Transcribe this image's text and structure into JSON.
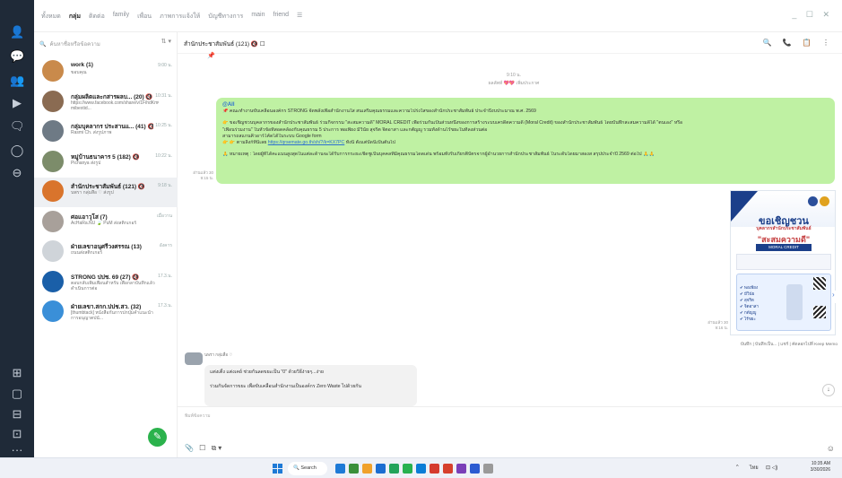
{
  "topbar": {
    "tabs": [
      "ทั้งหมด",
      "กลุ่ม",
      "ติดต่อ",
      "family",
      "เพื่อน",
      "ภาพการแจ้งให้",
      "บัญชีทางการ",
      "main",
      "friend"
    ],
    "active_tab": "กลุ่ม",
    "window_controls": "_ ☐ ✕"
  },
  "list": {
    "search_placeholder": "ค้นหาชื่อหรือข้อความ",
    "sort_label": "⇅ ▾",
    "chats": [
      {
        "name": "work (1)",
        "preview": "ขอบคุณ",
        "time": "9:00 น.",
        "color": "#c98a4b"
      },
      {
        "name": "กลุ่มผลิตและกสารผลบ... (20) 🔇",
        "preview": "https://www.facebook.com/share/v/1FihdKmCSu/?mibextid...",
        "time": "10:31 น.",
        "color": "#8a6b52"
      },
      {
        "name": "กลุ่มบุคลากร ประสานแ... (41) 🔇",
        "preview": "Rasmi Ch. ส่งรูปภาพ",
        "time": "10:25 น.",
        "color": "#6e7a85"
      },
      {
        "name": "หมู่บ้านธนาคาร 5 (182) 🔇",
        "preview": "Pichanya ส่งรูป",
        "time": "10:22 น.",
        "color": "#7c8c6a"
      },
      {
        "name": "สำนักประชาสัมพันธ์ (121) 🔇",
        "preview": "นพรา กลุ่มสื่อ ♡ ส่งรูป",
        "time": "9:18 น.",
        "color": "#d9742c"
      },
      {
        "name": "ศอแอาวุโส (7)",
        "preview": "AcHaRa.NU 🍃 PuM ส่งสติกเกอร์",
        "time": "เมื่อวาน",
        "color": "#a8a09a"
      },
      {
        "name": "ฝ่ายเลขาอนุศรีวงศรรณ (13)",
        "preview": "ถนนส่งสติกเกอร์",
        "time": "อังคาร",
        "color": "#cfd4d9"
      },
      {
        "name": "STRONG ปปช. 69 (27) 🔇",
        "preview": "ตอบกลับเพิ่มเพื่อนสำหรับ เพื่อกลาบันทึกแล้ว ดำเนินการต่อ",
        "time": "17.3.น.",
        "color": "#1a5fa8"
      },
      {
        "name": "ฝ่ายเลขา.สกก.ปปช.สว. (32)",
        "preview": "[thumbtack] หนังสือกันการปกปุ่มคำแนะนำการอนุญาตปนั...",
        "time": "17.3.น.",
        "color": "#3a8fd8"
      }
    ],
    "new_chat_icon": "chat-plus"
  },
  "conversation": {
    "title": "สำนักประชาสัมพันธ์ (121) 🔇 ☐",
    "tools": "🔍 📞 📋 ⋮",
    "pinned_line": "📌",
    "sys_time": "9:10 น.",
    "sys_text": "ผลลัพท์ 💖💖 เพิ่มประกาศ",
    "bubble_main": {
      "mention": "@All",
      "line1": "📌 คณะทำงานขับเคลื่อนองค์กร STRONG จัดพลังเพื่อสำนักงานใส สนเสริมคุณธรรมและความโปร่งใสของสำนักประชาสัมพันธ์ ประจำปีงบประมาณ พ.ศ. 2569",
      "line2": "👉 ขอเชิญชวนบุคลากรของสำนักประชาสัมพันธ์ ร่วมกิจกรรม \"สะสมความดี\" MORAL CREDIT เพื่อร่วมกันเป็นส่วนหนึ่งของการสร้างระบบเครดิตความดี (Moral Credit) ของสำนักประชาสัมพันธ์ โดยบันทึกสะสมความดีได้ \"ตนเอง\" หรือ",
      "line3": "\"เพื่อนร่วมงาน\" ในหัวข้อที่สอดคล้องกับคุณธรรม 5 ประการ พอเพียง มีวินัย สุจริต จิตอาสา และกตัญญู รวมทั้งด้านไร้ขยะในที่ลงส่วนต่อ",
      "line4": "สามารถสแกนคิวอาร์โค้ดได้ในระบบ Google form",
      "line5_prefix": "👉 👉 ตามลิงก์ที่นี่เลย ",
      "line5_link": "https://qrsemate.go.th/sh/?/k=KX7PC",
      "line5_suffix": " ทั้งนี้ ตั้งแต่บัดนี้เป็นต้นไป",
      "line6": "🙏 หมายเหตุ : โดยผู้ที่ได้คะแนนสูงสุดในแต่ละด้านจะได้รับการกระยะเชิดชูเป็นบุคคลที่มีคุณธรรมโดดเด่น พร้อมทั้งรับเกียรติบัตรจากผู้อำนวยการสำนักประชาสัมพันธ์ ในระดับโดยมาสองส สรุปประจำปี 2569 ต่อไป 🙏🙏",
      "time": "อ่านแล้ว 30\n9:15 น."
    },
    "poster": {
      "title": "ขอเชิญชวน",
      "subtitle": "บุคลากรสำนักประชาสัมพันธ์",
      "headline": "\"สะสมความดี\"",
      "tag": "MORAL CREDIT",
      "checklist": [
        "พอเพียง",
        "มีวินัย",
        "สุจริต",
        "จิตอาสา",
        "กตัญญู",
        "ไร้ขยะ"
      ],
      "time": "อ่านแล้ว 30\n9:16 น.",
      "actions": "บันทึก | บันทึกเป็น... | แชร์ | คัดลอกไปที่ Keep Memo"
    },
    "reply": {
      "sender": "นพรา กลุ่มสื่อ ♡",
      "text1": "แต่งเติ้ง แต่งเคย์ ช่วยกันลดขยะเป็น \"0\" ด้วยวิธีง่ายๆ...ง่าย",
      "text2": "ร่วมกันจัดการขยะ เพื่อขับเคลื่อนสำนักงานเป็นองค์กร Zero Waste ไปด้วยกัน"
    },
    "composer_placeholder": "พิมพ์ข้อความ",
    "composer_tools": "📎 ☐ ⧉▾",
    "scroll_down": "↓"
  },
  "taskbar": {
    "search_label": "Search",
    "lang": "ไทย",
    "time": "10:35 AM",
    "date": "3/30/2026",
    "apps_colors": [
      "#1e7ad6",
      "#3a8f3a",
      "#f0a12b",
      "#1b6dd1",
      "#22a35a",
      "#27b14f",
      "#0a7dd6",
      "#d53b2e",
      "#d6402c",
      "#7a3fb8",
      "#2b5bd1",
      "#9a9a9a"
    ]
  },
  "colors": {
    "bubble": "#bff1a3",
    "rail": "#1f2a38",
    "accent": "#2bb24c"
  }
}
